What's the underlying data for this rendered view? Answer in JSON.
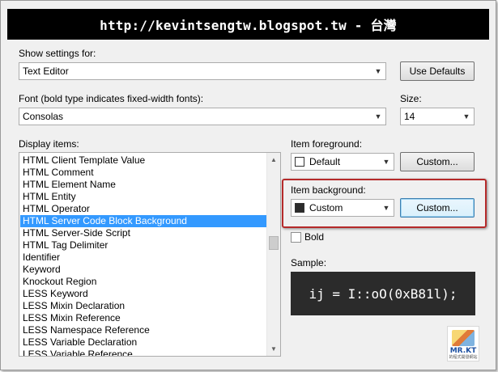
{
  "banner": {
    "text": "http://kevintsengtw.blogspot.tw - 台灣"
  },
  "show_settings": {
    "label": "Show settings for:",
    "value": "Text Editor",
    "use_defaults_label": "Use Defaults"
  },
  "font": {
    "label": "Font (bold type indicates fixed-width fonts):",
    "value": "Consolas"
  },
  "size": {
    "label": "Size:",
    "value": "14"
  },
  "display_items": {
    "label": "Display items:",
    "items": [
      "HTML Client Template Value",
      "HTML Comment",
      "HTML Element Name",
      "HTML Entity",
      "HTML Operator",
      "HTML Server Code Block Background",
      "HTML Server-Side Script",
      "HTML Tag Delimiter",
      "Identifier",
      "Keyword",
      "Knockout Region",
      "LESS Keyword",
      "LESS Mixin Declaration",
      "LESS Mixin Reference",
      "LESS Namespace Reference",
      "LESS Variable Declaration",
      "LESS Variable Reference"
    ],
    "selected_index": 5
  },
  "item_foreground": {
    "label": "Item foreground:",
    "value": "Default",
    "swatch_color": "#ffffff",
    "custom_label": "Custom..."
  },
  "item_background": {
    "label": "Item background:",
    "value": "Custom",
    "swatch_color": "#2b2b2b",
    "custom_label": "Custom..."
  },
  "bold": {
    "label": "Bold",
    "checked": false
  },
  "sample": {
    "label": "Sample:",
    "text": "ij = I::oO(0xB81l);",
    "background": "#2b2b2b",
    "foreground": "#ffffff"
  },
  "logo": {
    "brand": "MR.KT",
    "tagline": "的程式開發網站"
  },
  "colors": {
    "selection": "#3399ff",
    "highlight_border": "#b52a2a"
  }
}
